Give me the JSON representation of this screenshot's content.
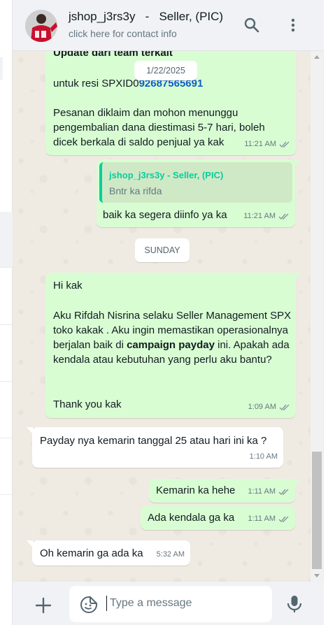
{
  "header": {
    "contact_name": "jshop_j3rs3y   -   Seller, (PIC)",
    "contact_sub": "click here for contact info",
    "avatar_icon": "avatar-photo",
    "search_icon": "search-icon",
    "menu_icon": "more-vertical-icon"
  },
  "messages": {
    "m1": {
      "title": "Update dari team terkait",
      "resi_prefix": "untuk resi SPXID0",
      "resi_link": "92687565691",
      "body": "Pesanan diklaim dan mohon menunggu pengembalian dana diestimasi 5-7 hari, boleh dicek berkala di saldo penjual ya kak",
      "time": "11:21 AM"
    },
    "date_pill": "1/22/2025",
    "m2": {
      "quote_author": "jshop_j3rs3y - Seller, (PIC)",
      "quote_text": "Bntr ka rifda",
      "text": "baik ka segera diinfo ya ka",
      "time": "11:21 AM"
    },
    "day_pill": "SUNDAY",
    "m3": {
      "line1": "Hi kak",
      "line2_before": "Aku Rifdah Nisrina selaku Seller Management SPX toko kakak . Aku ingin memastikan operasionalnya berjalan baik di ",
      "line2_bold": "campaign payday",
      "line2_after": " ini. Apakah ada kendala atau kebutuhan yang perlu aku bantu?",
      "line3": "Thank you kak",
      "time": "1:09 AM"
    },
    "m4": {
      "text": "Payday nya kemarin tanggal 25 atau hari ini ka ?",
      "time": "1:10 AM"
    },
    "m5": {
      "text": "Kemarin ka hehe",
      "time": "1:11 AM"
    },
    "m6": {
      "text": "Ada kendala ga ka",
      "time": "1:11 AM"
    },
    "m7": {
      "text": "Oh kemarin ga ada ka",
      "time": "5:32 AM"
    }
  },
  "footer": {
    "placeholder": "Type a message",
    "attach_icon": "plus-icon",
    "sticker_icon": "sticker-icon",
    "mic_icon": "microphone-icon"
  },
  "colors": {
    "outgoing_bubble": "#d9fdd3",
    "incoming_bubble": "#ffffff",
    "chat_background": "#efeae2",
    "read_tick": "#8696a0",
    "link_blue": "#0b5fc9",
    "quote_accent": "#06cf9c"
  }
}
